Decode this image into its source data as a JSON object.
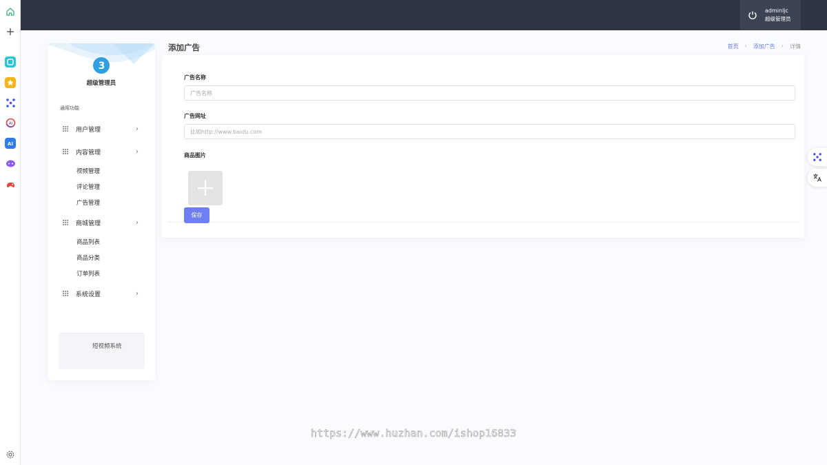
{
  "user": {
    "name": "adminljc",
    "role": "超级管理员"
  },
  "sidebar": {
    "name": "超级管理员",
    "group": "通用功能",
    "menus": [
      {
        "label": "用户管理",
        "children": []
      },
      {
        "label": "内容管理",
        "children": [
          "视频管理",
          "评论管理",
          "广告管理"
        ]
      },
      {
        "label": "商城管理",
        "children": [
          "商品列表",
          "商品分类",
          "订单列表"
        ]
      },
      {
        "label": "系统设置",
        "children": []
      }
    ],
    "footer": "短视频系统"
  },
  "page": {
    "title": "添加广告",
    "breadcrumb": [
      "首页",
      "添加广告",
      "详情"
    ]
  },
  "form": {
    "name_label": "广告名称",
    "name_placeholder": "广告名称",
    "url_label": "广告网址",
    "url_placeholder": "比如http://www.baidu.com",
    "image_label": "商品图片",
    "save_label": "保存"
  },
  "watermark": "https://www.huzhan.com/ishop16833",
  "colors": {
    "topbar": "#2f3542",
    "accent": "#6d7ff2",
    "background": "#fafbfe"
  },
  "icons": {
    "rail": [
      "home-icon",
      "plus-icon",
      "app-icon-1",
      "star-app-icon",
      "network-app-icon",
      "ai-ring-app-icon",
      "ai-app-icon",
      "chat-bubble-app-icon",
      "gamepad-app-icon",
      "settings-icon"
    ],
    "float": [
      "network-float-icon",
      "translate-icon"
    ]
  }
}
